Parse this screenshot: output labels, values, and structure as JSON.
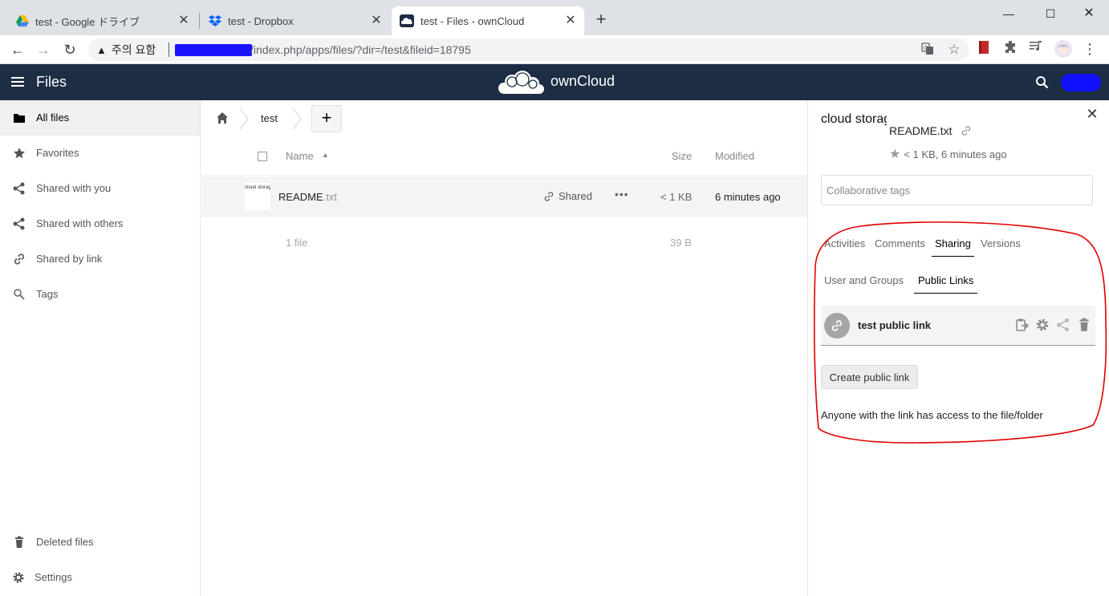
{
  "browser": {
    "tabs": [
      {
        "title": "test - Google ドライブ",
        "icon": "google-drive-icon"
      },
      {
        "title": "test - Dropbox",
        "icon": "dropbox-icon"
      },
      {
        "title": "test - Files - ownCloud",
        "icon": "owncloud-icon",
        "active": true
      }
    ],
    "security_label": "주의 요함",
    "url_path": "/index.php/apps/files/?dir=/test&fileid=18795"
  },
  "header": {
    "app_name": "Files",
    "brand": "ownCloud"
  },
  "sidebar": {
    "items": [
      {
        "label": "All files",
        "icon": "folder-icon",
        "active": true
      },
      {
        "label": "Favorites",
        "icon": "star-icon"
      },
      {
        "label": "Shared with you",
        "icon": "share-icon"
      },
      {
        "label": "Shared with others",
        "icon": "share-icon"
      },
      {
        "label": "Shared by link",
        "icon": "link-icon"
      },
      {
        "label": "Tags",
        "icon": "tag-search-icon"
      }
    ],
    "bottom": [
      {
        "label": "Deleted files",
        "icon": "trash-icon"
      },
      {
        "label": "Settings",
        "icon": "gear-icon"
      }
    ]
  },
  "breadcrumb": {
    "current": "test",
    "new_label": "+"
  },
  "file_list": {
    "columns": {
      "name": "Name",
      "size": "Size",
      "modified": "Modified"
    },
    "files": [
      {
        "base": "README",
        "ext": ".txt",
        "thumb_text": "cloud storage",
        "shared_label": "Shared",
        "size": "< 1 KB",
        "modified": "6 minutes ago"
      }
    ],
    "summary": {
      "count": "1 file",
      "size": "39 B"
    }
  },
  "details": {
    "preview_text": "cloud storage",
    "filename": "README.txt",
    "meta": "< 1 KB, 6 minutes ago",
    "tags_placeholder": "Collaborative tags",
    "tabs": [
      "Activities",
      "Comments",
      "Sharing",
      "Versions"
    ],
    "active_tab": "Sharing",
    "sharing_subtabs": [
      "User and Groups",
      "Public Links"
    ],
    "active_subtab": "Public Links",
    "public_link": {
      "name": "test public link"
    },
    "create_link_label": "Create public link",
    "hint": "Anyone with the link has access to the file/folder"
  },
  "colors": {
    "header_bg": "#1d2d44",
    "annotation": "#e00000"
  }
}
